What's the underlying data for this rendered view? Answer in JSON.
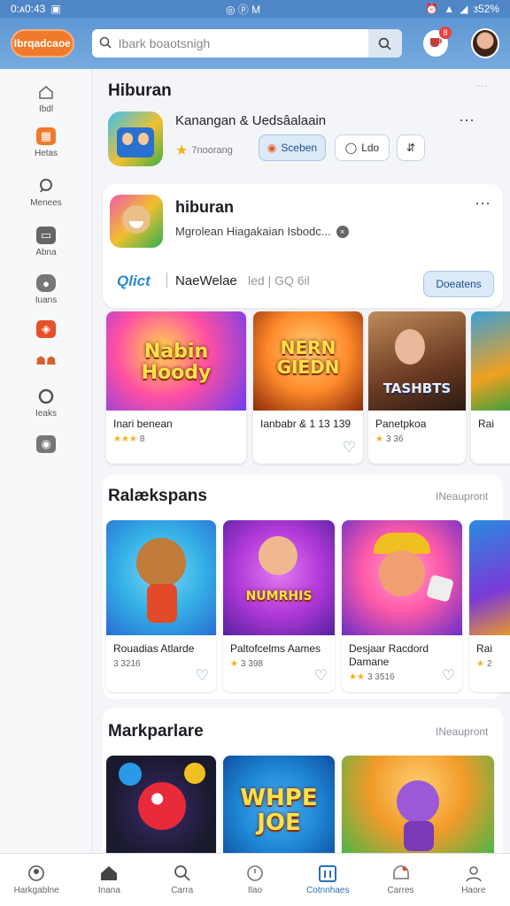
{
  "status": {
    "time": "0:ᴀ0:43",
    "icons_left": "◎ ⓟ M",
    "battery": "ᴣ52%"
  },
  "header": {
    "brand": "Ibrqadcaoe",
    "search_placeholder": "Ibark boaotsnigh",
    "notification_count": "8"
  },
  "sidebar": {
    "items": [
      {
        "label": "Ibdl",
        "icon": "home-outline-icon"
      },
      {
        "label": "Hetas",
        "icon": "grid-icon"
      },
      {
        "label": "Menees",
        "icon": "search-icon"
      },
      {
        "label": "Abna",
        "icon": "chat-icon"
      },
      {
        "label": "Iuans",
        "icon": "comment-icon"
      },
      {
        "label": "",
        "icon": "games-icon"
      },
      {
        "label": "",
        "icon": "people-icon"
      },
      {
        "label": "Ieaks",
        "icon": "circle-icon"
      },
      {
        "label": "",
        "icon": "camera-icon"
      }
    ]
  },
  "section1": {
    "title": "Hiburan",
    "app": {
      "name": "Kanangan & Uedsâalaain",
      "rating_text": "7noorang",
      "btn_primary": "Sceben",
      "btn_secondary": "Ldo",
      "btn_third": "⇵"
    }
  },
  "featured": {
    "title": "hiburan",
    "subtitle": "Mgrolean Hiagakaian Isbodc...",
    "brand": "Qlict",
    "tagline": "NaeWelae",
    "tag_extra": "led | GQ 6il",
    "button": "Doeatens"
  },
  "row1": [
    {
      "art_text": "Nabin Hoody",
      "title": "Inari benean",
      "rating": "8",
      "colors": [
        "#ff4fa3",
        "#6b3df0"
      ]
    },
    {
      "art_text": "NERN GIEDN",
      "title": "Ianbabr & 1 13 139",
      "rating": "",
      "colors": [
        "#ffb13b",
        "#b23b14"
      ]
    },
    {
      "art_text": "TASHBTS",
      "title": "Panetpkoa",
      "rating": "3 36",
      "colors": [
        "#8a6a4a",
        "#3a2418"
      ]
    },
    {
      "art_text": "",
      "title": "Rai",
      "rating": "",
      "colors": [
        "#3aa0d8",
        "#f0a020"
      ]
    }
  ],
  "section2": {
    "title": "Ralækspans",
    "see_all": "INeaupront"
  },
  "row2": [
    {
      "title": "Rouadias Atlarde",
      "rating": "3 3216",
      "colors": [
        "#34b0e6",
        "#2a6ed4"
      ]
    },
    {
      "art_text": "NUMRHIS",
      "title": "Paltofcelms Aames",
      "rating": "3 398",
      "colors": [
        "#b23ad8",
        "#5520a0"
      ]
    },
    {
      "title": "Desjaar Racdord Damane",
      "rating": "3 3516",
      "colors": [
        "#ff5aa8",
        "#6a2ec8"
      ]
    },
    {
      "title": "Rai",
      "rating": "2",
      "colors": [
        "#2a8ae0",
        "#7a3ad8"
      ]
    }
  ],
  "section3": {
    "title": "Markparlare",
    "see_all": "INeaupront"
  },
  "row3": [
    {
      "colors": [
        "#1a1a2e",
        "#3a2a6a"
      ]
    },
    {
      "art_text": "WHPE JOE",
      "colors": [
        "#1f8ad8",
        "#0f4ea0"
      ]
    },
    {
      "colors": [
        "#f29a2a",
        "#3ab84a"
      ]
    }
  ],
  "bottom_nav": [
    {
      "label": "Harkgablne",
      "icon": "person-circle-icon"
    },
    {
      "label": "Inana",
      "icon": "home-icon"
    },
    {
      "label": "Carra",
      "icon": "search-icon"
    },
    {
      "label": "Ilao",
      "icon": "clock-icon"
    },
    {
      "label": "Cotnnhaes",
      "icon": "store-icon",
      "active": true
    },
    {
      "label": "Carres",
      "icon": "game-icon"
    },
    {
      "label": "Haore",
      "icon": "profile-icon"
    }
  ]
}
